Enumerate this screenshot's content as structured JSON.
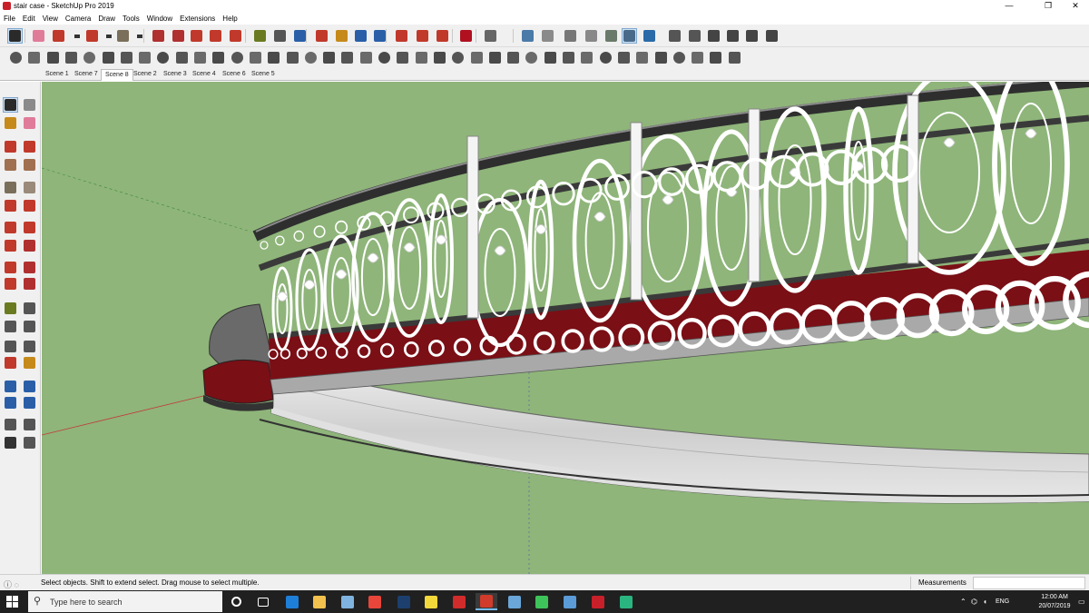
{
  "window": {
    "title": "stair case - SketchUp Pro 2019",
    "minimize": "—",
    "maximize": "❐",
    "close": "✕"
  },
  "menu": [
    "File",
    "Edit",
    "View",
    "Camera",
    "Draw",
    "Tools",
    "Window",
    "Extensions",
    "Help"
  ],
  "toolbar_main": [
    {
      "name": "select-tool-icon",
      "color": "#2a2a2a",
      "active": true
    },
    {
      "name": "eraser-icon",
      "color": "#e07b9a"
    },
    {
      "name": "line-tool-icon",
      "color": "#c0392b"
    },
    {
      "name": "line-dropdown-icon",
      "color": "#333333"
    },
    {
      "name": "arc-tool-icon",
      "color": "#c0392b"
    },
    {
      "name": "arc-dropdown-icon",
      "color": "#333333"
    },
    {
      "name": "shape-tool-icon",
      "color": "#7a6f5a"
    },
    {
      "name": "shape-dropdown-icon",
      "color": "#333333"
    },
    {
      "name": "push-pull-icon",
      "color": "#b03030"
    },
    {
      "name": "offset-icon",
      "color": "#b03030"
    },
    {
      "name": "move-tool-icon",
      "color": "#c0392b"
    },
    {
      "name": "rotate-tool-icon",
      "color": "#c0392b"
    },
    {
      "name": "scale-tool-icon",
      "color": "#c0392b"
    },
    {
      "name": "tape-measure-icon",
      "color": "#6a7a20"
    },
    {
      "name": "text-tool-icon",
      "color": "#555555"
    },
    {
      "name": "paint-bucket-icon",
      "color": "#2a5fa8"
    },
    {
      "name": "orbit-icon",
      "color": "#c0392b"
    },
    {
      "name": "pan-icon",
      "color": "#c58a1a"
    },
    {
      "name": "zoom-icon",
      "color": "#2a5fa8"
    },
    {
      "name": "zoom-extents-icon",
      "color": "#2a5fa8"
    },
    {
      "name": "warehouse-icon",
      "color": "#c0392b"
    },
    {
      "name": "extension-warehouse-icon",
      "color": "#c0392b"
    },
    {
      "name": "layout-icon",
      "color": "#c0392b"
    },
    {
      "name": "ruby-icon",
      "color": "#b01020"
    },
    {
      "name": "user-account-icon",
      "color": "#666666"
    },
    {
      "name": "xray-icon",
      "color": "#4a7aa8"
    },
    {
      "name": "back-edges-icon",
      "color": "#8a8a8a"
    },
    {
      "name": "wireframe-icon",
      "color": "#777777"
    },
    {
      "name": "hidden-line-icon",
      "color": "#888888"
    },
    {
      "name": "shaded-icon",
      "color": "#6a7a6a"
    },
    {
      "name": "shaded-textures-icon",
      "color": "#4a6a8a",
      "active": true
    },
    {
      "name": "monochrome-icon",
      "color": "#2a6aa8"
    },
    {
      "name": "iso-view-icon",
      "color": "#555555"
    },
    {
      "name": "top-view-icon",
      "color": "#555555"
    },
    {
      "name": "front-view-icon",
      "color": "#444444"
    },
    {
      "name": "right-view-icon",
      "color": "#444444"
    },
    {
      "name": "back-view-icon",
      "color": "#444444"
    },
    {
      "name": "left-view-icon",
      "color": "#444444"
    }
  ],
  "toolbar_ext": [
    "freehand-icon",
    "bezier-icon",
    "ext-tool-3-icon",
    "ext-tool-4-icon",
    "ext-tool-5-icon",
    "ext-tool-6-icon",
    "ext-tool-7-icon",
    "ext-tool-8-icon",
    "ext-tool-9-icon",
    "ext-tool-10-icon",
    "ext-tool-11-icon",
    "ext-tool-12-icon",
    "ext-tool-13-icon",
    "ext-tool-14-icon",
    "ext-tool-15-icon",
    "ext-tool-16-icon",
    "ext-tool-17-icon",
    "ext-tool-18-icon",
    "ext-tool-19-icon",
    "ext-tool-20-icon",
    "ext-tool-21-icon",
    "ext-tool-22-icon",
    "ext-tool-23-icon",
    "ext-tool-24-icon",
    "ext-tool-25-icon",
    "ext-tool-26-icon",
    "ext-tool-27-icon",
    "ext-tool-28-icon",
    "ext-tool-29-icon",
    "ext-tool-30-icon",
    "ext-tool-31-icon",
    "ext-tool-32-icon",
    "ext-tool-33-icon",
    "ext-tool-34-icon",
    "ext-tool-35-icon",
    "ext-tool-36-icon",
    "ext-tool-37-icon",
    "ext-tool-38-icon",
    "ext-tool-39-icon",
    "ext-tool-40-icon"
  ],
  "scenes": [
    "Scene 1",
    "Scene 7",
    "Scene 8",
    "Scene 2",
    "Scene 3",
    "Scene 4",
    "Scene 6",
    "Scene 5"
  ],
  "active_scene": "Scene 8",
  "left_tools": [
    "select-icon",
    "component-icon",
    "paint-bucket-icon",
    "eraser-icon",
    "line-icon",
    "freehand-icon",
    "rectangle-icon",
    "rotated-rectangle-icon",
    "circle-icon",
    "polygon-icon",
    "arc-icon",
    "two-point-arc-icon",
    "three-point-arc-icon",
    "pie-icon",
    "move-icon",
    "push-pull-icon",
    "rotate-icon",
    "follow-me-icon",
    "scale-icon",
    "offset-icon",
    "tape-measure-icon",
    "dimension-icon",
    "protractor-icon",
    "text-icon",
    "axes-icon",
    "3d-text-icon",
    "orbit-icon",
    "pan-icon",
    "zoom-icon",
    "zoom-window-icon",
    "zoom-extents-icon",
    "previous-view-icon",
    "position-camera-icon",
    "look-around-icon",
    "walk-icon",
    "section-plane-icon"
  ],
  "status": {
    "hint": "Select objects. Shift to extend select. Drag mouse to select multiple.",
    "measurements_label": "Measurements",
    "measurements_value": ""
  },
  "taskbar": {
    "search_placeholder": "Type here to search",
    "apps": [
      {
        "name": "cortana-icon",
        "color": "#ffffff"
      },
      {
        "name": "task-view-icon",
        "color": "#ffffff"
      },
      {
        "name": "edge-icon",
        "color": "#1e7fd8"
      },
      {
        "name": "file-explorer-icon",
        "color": "#f2c14e"
      },
      {
        "name": "store-icon",
        "color": "#7fb3e0"
      },
      {
        "name": "chrome-icon",
        "color": "#e8463a"
      },
      {
        "name": "photoshop-icon",
        "color": "#1c3f6e"
      },
      {
        "name": "sticky-notes-icon",
        "color": "#f2d83a"
      },
      {
        "name": "autocad-icon",
        "color": "#d22b2b"
      },
      {
        "name": "sketchup-icon",
        "color": "#d03b2b",
        "active": true
      },
      {
        "name": "network-app-icon",
        "color": "#6aa6d8"
      },
      {
        "name": "whatsapp-icon",
        "color": "#3ec35a"
      },
      {
        "name": "layout-app-icon",
        "color": "#5a9bd8"
      },
      {
        "name": "style-builder-icon",
        "color": "#c8202a"
      },
      {
        "name": "green-app-icon",
        "color": "#2ab580"
      }
    ],
    "language": "ENG",
    "time": "12:00 AM",
    "date": "20/07/2019"
  },
  "colors": {
    "sky": "#8fb57a",
    "railing_white": "#ffffff",
    "railing_dark": "#3a3a3a",
    "carpet": "#7a0f16",
    "marble": "#d9d9d9"
  }
}
